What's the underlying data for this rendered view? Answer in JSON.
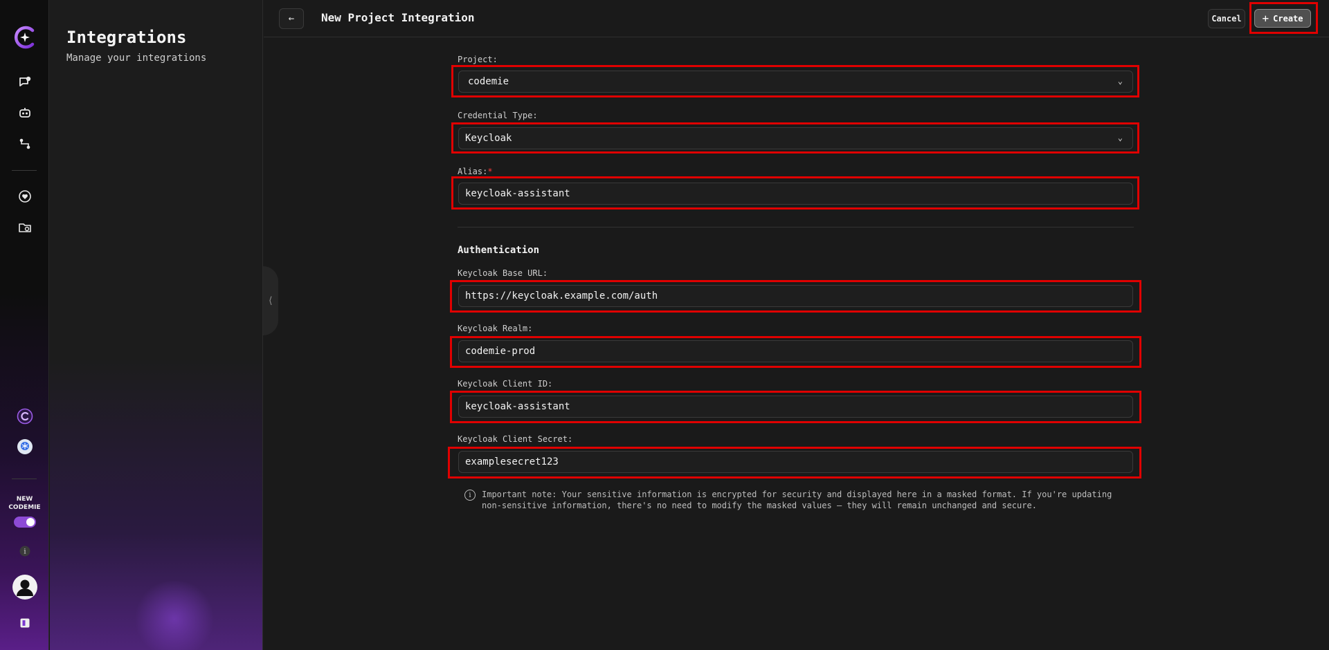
{
  "rail": {
    "new_codemie_label_1": "NEW",
    "new_codemie_label_2": "CODEMIE",
    "new_codemie_toggle_on": true,
    "icons": [
      "codemie-logo-icon",
      "chat-add-icon",
      "assistant-bot-icon",
      "workflow-icon",
      "heart-icon",
      "data-folder-icon",
      "codemie-circle-icon",
      "kubernetes-icon",
      "info-icon",
      "user-avatar-icon",
      "help-book-icon"
    ]
  },
  "panel": {
    "title": "Integrations",
    "subtitle": "Manage your integrations",
    "collapse_icon": "⟨"
  },
  "header": {
    "back_icon": "←",
    "title": "New Project Integration",
    "cancel_label": "Cancel",
    "create_icon": "+",
    "create_label": "Create"
  },
  "form": {
    "project": {
      "label": "Project:",
      "value": "codemie"
    },
    "credential_type": {
      "label": "Credential Type:",
      "value": "Keycloak"
    },
    "alias": {
      "label": "Alias:",
      "required_mark": "*",
      "value": "keycloak-assistant"
    },
    "auth_section_title": "Authentication",
    "base_url": {
      "label": "Keycloak Base URL:",
      "value": "https://keycloak.example.com/auth"
    },
    "realm": {
      "label": "Keycloak Realm:",
      "value": "codemie-prod"
    },
    "client_id": {
      "label": "Keycloak Client ID:",
      "value": "keycloak-assistant"
    },
    "client_secret": {
      "label": "Keycloak Client Secret:",
      "value": "examplesecret123"
    },
    "note_line_1": "Important note: Your sensitive information is encrypted for security and displayed here in a masked format. If you're updating",
    "note_line_2": "non-sensitive information, there's no need to modify the masked values — they will remain unchanged and secure."
  },
  "colors": {
    "highlight": "#e00000",
    "accent": "#8d4bd6",
    "background": "#1a1a1a"
  }
}
